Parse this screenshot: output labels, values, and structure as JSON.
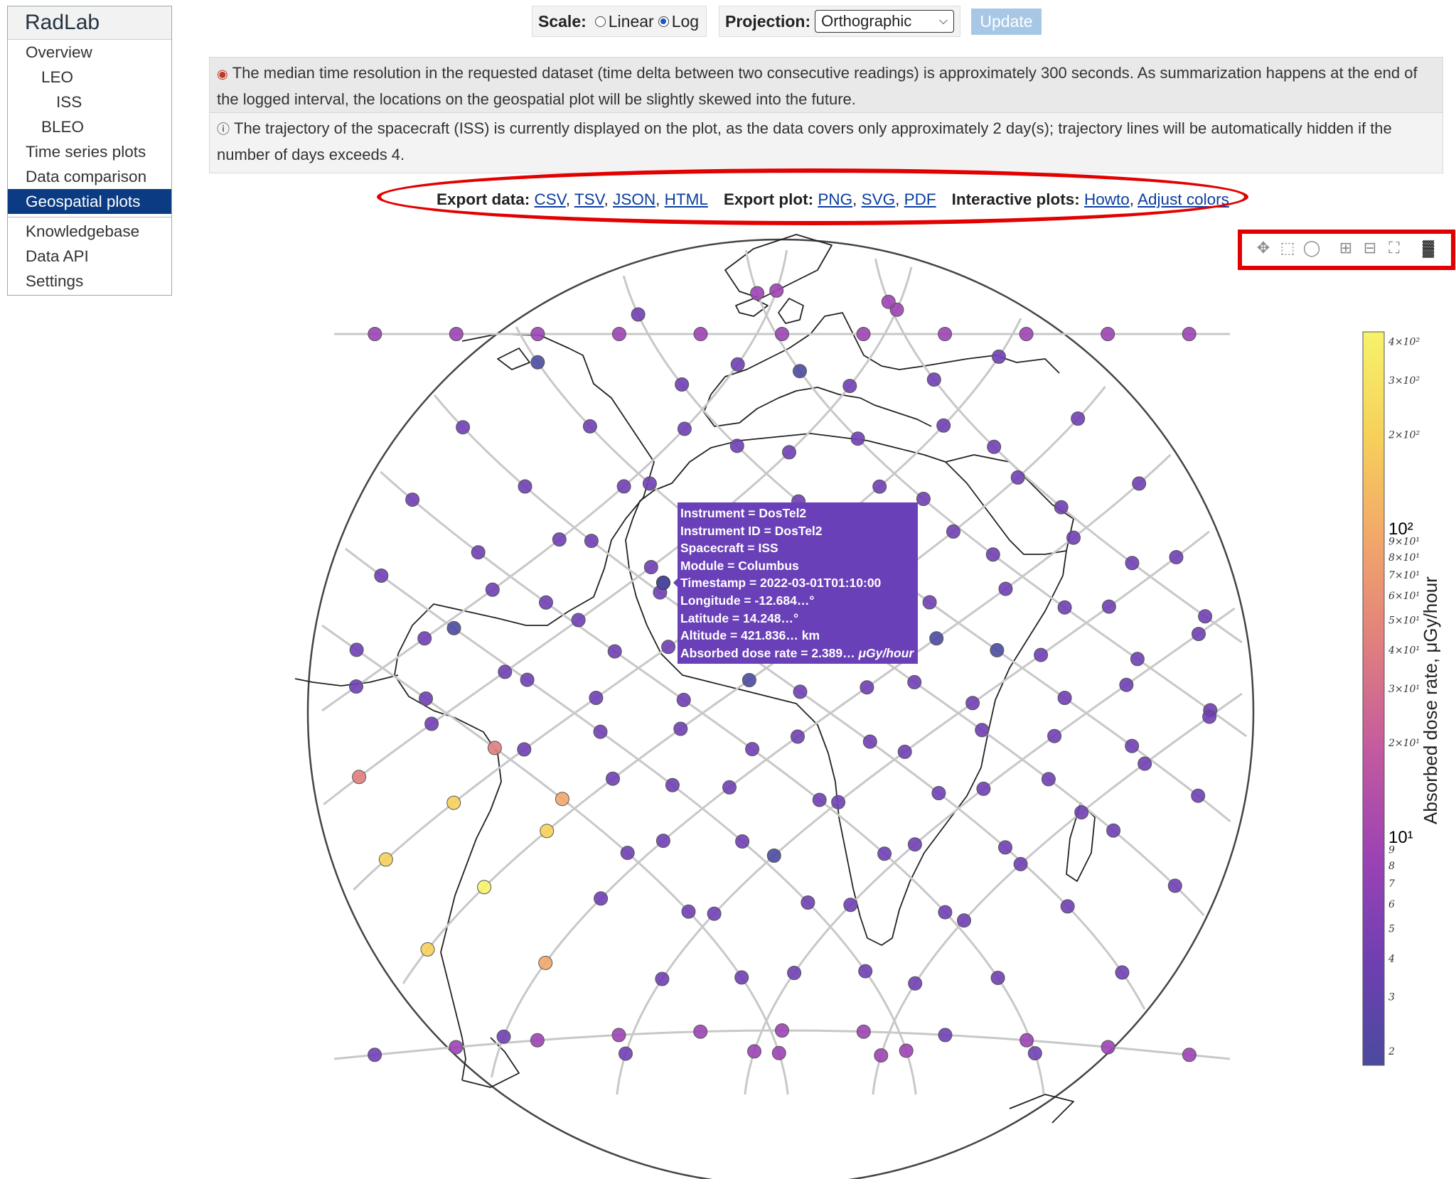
{
  "sidebar": {
    "brand": "RadLab",
    "items": [
      {
        "label": "Overview",
        "level": 0
      },
      {
        "label": "LEO",
        "level": 1
      },
      {
        "label": "ISS",
        "level": 2
      },
      {
        "label": "BLEO",
        "level": 1
      },
      {
        "label": "Time series plots",
        "level": 0
      },
      {
        "label": "Data comparison",
        "level": 0
      },
      {
        "label": "Geospatial plots",
        "level": 0,
        "active": true
      }
    ],
    "items2": [
      {
        "label": "Knowledgebase"
      },
      {
        "label": "Data API"
      },
      {
        "label": "Settings"
      }
    ]
  },
  "controls": {
    "scale_label": "Scale:",
    "scale_linear": "Linear",
    "scale_log": "Log",
    "scale_selected": "Log",
    "projection_label": "Projection:",
    "projection_value": "Orthographic",
    "update_label": "Update"
  },
  "notices": {
    "first": "The median time resolution in the requested dataset (time delta between two consecutive readings) is approximately 300 seconds. As summarization happens at the end of the logged interval, the locations on the geospatial plot will be slightly skewed into the future.",
    "second": "The trajectory of the spacecraft (ISS) is currently displayed on the plot, as the data covers only approximately 2 day(s); trajectory lines will be automatically hidden if the number of days exceeds 4."
  },
  "export": {
    "data_label": "Export data:",
    "data_links": [
      "CSV",
      "TSV",
      "JSON",
      "HTML"
    ],
    "plot_label": "Export plot:",
    "plot_links": [
      "PNG",
      "SVG",
      "PDF"
    ],
    "interactive_label": "Interactive plots:",
    "interactive_links": [
      "Howto",
      "Adjust colors"
    ]
  },
  "modebar": [
    "pan-icon",
    "box-select-icon",
    "lasso-icon",
    "zoom-in-icon",
    "zoom-out-icon",
    "reset-icon",
    "plotly-logo-icon"
  ],
  "tooltip": {
    "rows": [
      {
        "key": "Instrument",
        "value": "DosTel2"
      },
      {
        "key": "Instrument ID",
        "value": "DosTel2"
      },
      {
        "key": "Spacecraft",
        "value": "ISS"
      },
      {
        "key": "Module",
        "value": "Columbus"
      },
      {
        "key": "Timestamp",
        "value": "2022-03-01T01:10:00"
      },
      {
        "key": "Longitude",
        "value": "-12.684…°"
      },
      {
        "key": "Latitude",
        "value": "14.248…°"
      },
      {
        "key": "Altitude",
        "value": "421.836… km"
      },
      {
        "key": "Absorbed dose rate",
        "value": "2.389…",
        "unit": "μGy/hour"
      }
    ]
  },
  "colorbar": {
    "title": "Absorbed dose rate, μGy/hour",
    "scale": "log",
    "range": [
      1.8,
      430
    ],
    "ticks": [
      {
        "v": 400,
        "label": "4×10²"
      },
      {
        "v": 300,
        "label": "3×10²"
      },
      {
        "v": 200,
        "label": "2×10²"
      },
      {
        "v": 100,
        "label": "10²",
        "major": true
      },
      {
        "v": 90,
        "label": "9×10¹"
      },
      {
        "v": 80,
        "label": "8×10¹"
      },
      {
        "v": 70,
        "label": "7×10¹"
      },
      {
        "v": 60,
        "label": "6×10¹"
      },
      {
        "v": 50,
        "label": "5×10¹"
      },
      {
        "v": 40,
        "label": "4×10¹"
      },
      {
        "v": 30,
        "label": "3×10¹"
      },
      {
        "v": 20,
        "label": "2×10¹"
      },
      {
        "v": 10,
        "label": "10¹",
        "major": true
      },
      {
        "v": 9,
        "label": "9"
      },
      {
        "v": 8,
        "label": "8"
      },
      {
        "v": 7,
        "label": "7"
      },
      {
        "v": 6,
        "label": "6"
      },
      {
        "v": 5,
        "label": "5"
      },
      {
        "v": 4,
        "label": "4"
      },
      {
        "v": 3,
        "label": "3"
      },
      {
        "v": 2,
        "label": "2"
      }
    ],
    "colors": [
      "#4b4a9e",
      "#6f3fb2",
      "#9c43b4",
      "#c35a9f",
      "#e07e7e",
      "#f2a66a",
      "#f6d05a",
      "#f6f36a"
    ]
  }
}
